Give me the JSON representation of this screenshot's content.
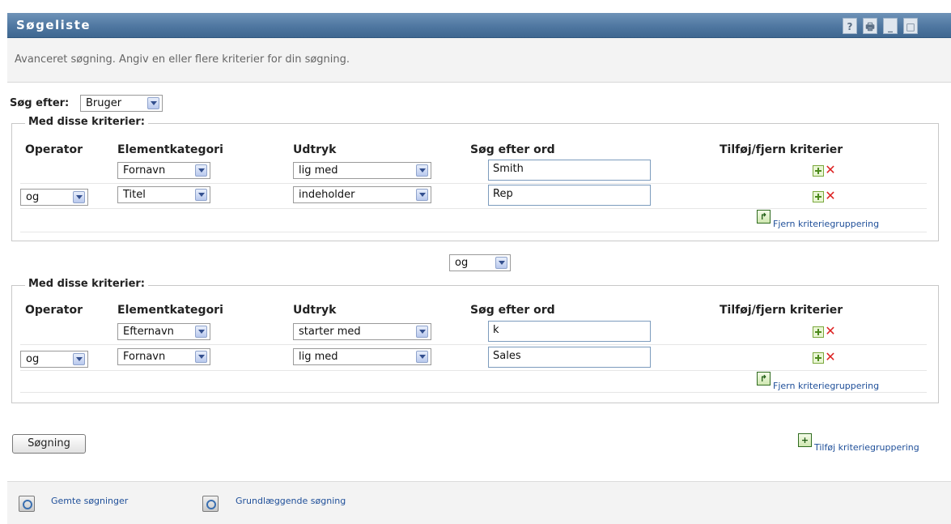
{
  "window": {
    "title": "Søgeliste",
    "buttons": [
      "?",
      "🖶",
      "_",
      "□"
    ]
  },
  "description": "Avanceret søgning. Angiv en eller flere kriterier for din søgning.",
  "search_for": {
    "label": "Søg efter:",
    "value": "Bruger"
  },
  "columns": {
    "operator": "Operator",
    "category": "Elementkategori",
    "expression": "Udtryk",
    "term": "Søg efter ord",
    "addremove": "Tilføj/fjern kriterier"
  },
  "groups": [
    {
      "legend": "Med disse kriterier:",
      "rows": [
        {
          "operator": "",
          "category": "Fornavn",
          "expression": "lig med",
          "term": "Smith"
        },
        {
          "operator": "og",
          "category": "Titel",
          "expression": "indeholder",
          "term": "Rep"
        }
      ],
      "remove_link": "Fjern kriteriegruppering"
    },
    {
      "legend": "Med disse kriterier:",
      "rows": [
        {
          "operator": "",
          "category": "Efternavn",
          "expression": "starter med",
          "term": "k"
        },
        {
          "operator": "og",
          "category": "Fornavn",
          "expression": "lig med",
          "term": "Sales"
        }
      ],
      "remove_link": "Fjern kriteriegruppering"
    }
  ],
  "group_connector": "og",
  "search_button": "Søgning",
  "add_group_link": "Tilføj kriteriegruppering",
  "footer": {
    "saved": "Gemte søgninger",
    "basic": "Grundlæggende søgning"
  },
  "colors": {
    "titlebar": "#4f77a1",
    "link": "#1f4f99"
  }
}
